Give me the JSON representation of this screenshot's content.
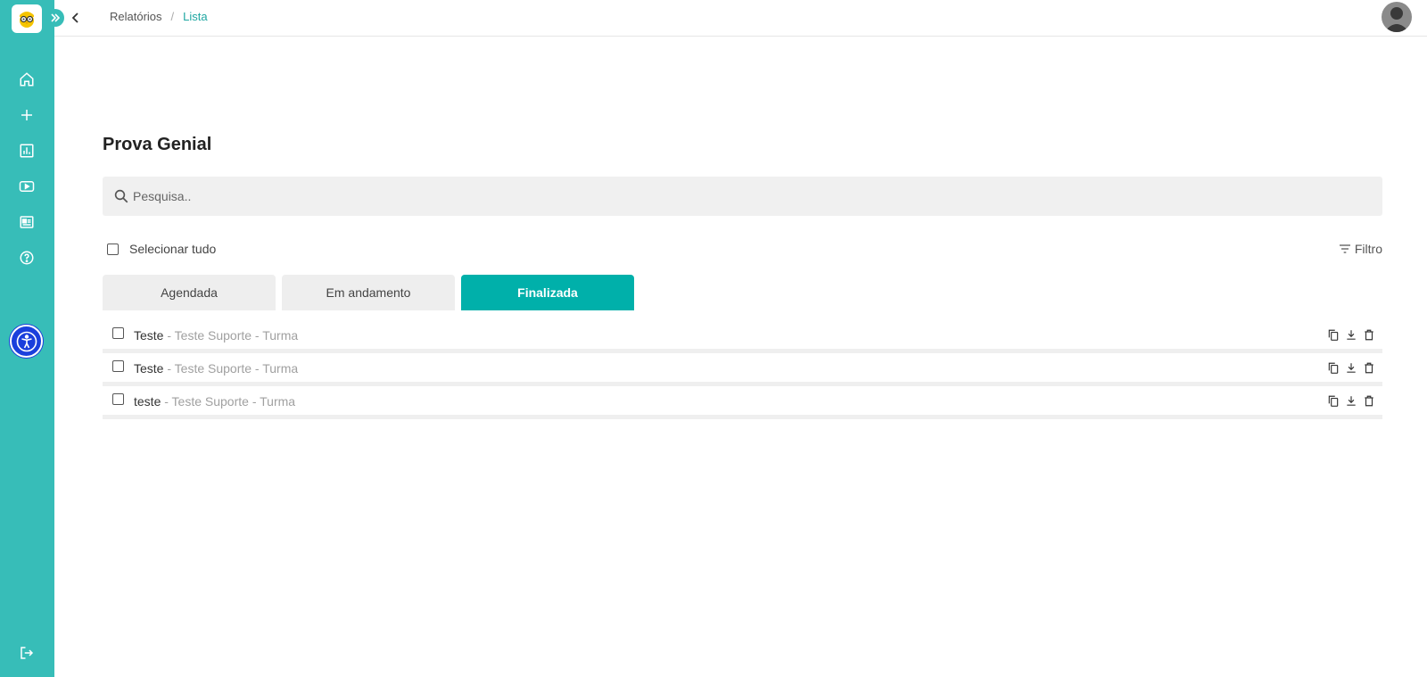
{
  "topbar": {
    "breadcrumb": {
      "parent": "Relatórios",
      "separator": "/",
      "current": "Lista"
    }
  },
  "main": {
    "title": "Prova Genial",
    "search": {
      "placeholder": "Pesquisa.."
    },
    "select_all_label": "Selecionar tudo",
    "filter_label": "Filtro",
    "tabs": [
      {
        "label": "Agendada"
      },
      {
        "label": "Em andamento"
      },
      {
        "label": "Finalizada"
      }
    ],
    "active_tab": "Finalizada",
    "rows": [
      {
        "title": "Teste",
        "subtitle": " - Teste Suporte - Turma"
      },
      {
        "title": "Teste",
        "subtitle": " - Teste Suporte - Turma"
      },
      {
        "title": "teste",
        "subtitle": " - Teste Suporte - Turma"
      }
    ]
  },
  "sidebar": {
    "icons": [
      "home-icon",
      "plus-icon",
      "chart-icon",
      "video-icon",
      "news-icon",
      "help-icon",
      "accessibility-icon",
      "logout-icon"
    ]
  },
  "colors": {
    "sidebar": "#37bdb8",
    "accent": "#00b0aa",
    "breadcrumb_active": "#1fa7a2",
    "accessibility": "#1a3fdc"
  }
}
